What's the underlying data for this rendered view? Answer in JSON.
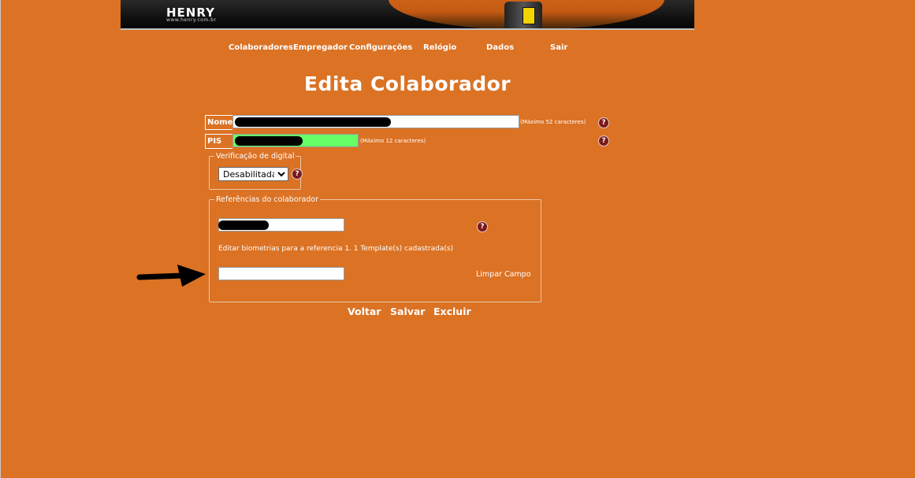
{
  "header": {
    "logo": "HENRY",
    "logo_sub": "www.henry.com.br"
  },
  "nav": [
    "Colaboradores",
    "Empregador",
    "Configurações",
    "Relógio",
    "Dados",
    "Sair"
  ],
  "title": "Edita Colaborador",
  "form": {
    "nome_label": "Nome",
    "nome_note": "(Máximo 52 caracteres)",
    "pis_label": "PIS",
    "pis_note": "(Máximo 12 caracteres)",
    "help_glyph": "?"
  },
  "verificacao": {
    "legend": "Verificação de digital",
    "selected": "Desabilitada"
  },
  "referencias": {
    "legend": "Referências do colaborador",
    "biometria_text": "Editar biometrias para a referencia 1. 1 Template(s) cadastrada(s)",
    "limpar": "Limpar Campo"
  },
  "actions": {
    "voltar": "Voltar",
    "salvar": "Salvar",
    "excluir": "Excluir"
  },
  "colors": {
    "background": "#db7224",
    "pis_field": "#66ff66",
    "help_icon": "#7a1a1a"
  }
}
